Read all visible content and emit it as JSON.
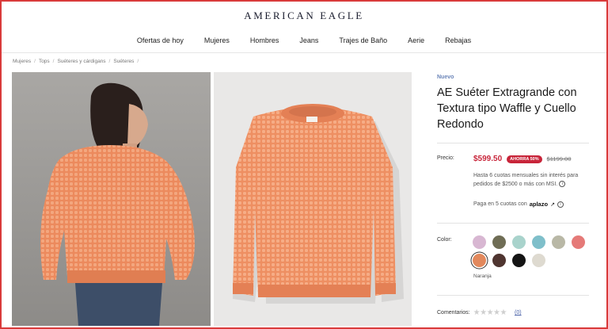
{
  "header": {
    "logo": "AMERICAN EAGLE",
    "nav": [
      "Ofertas de hoy",
      "Mujeres",
      "Hombres",
      "Jeans",
      "Trajes de Baño",
      "Aerie",
      "Rebajas"
    ]
  },
  "breadcrumb": [
    "Mujeres",
    "Tops",
    "Suéteres y cárdigans",
    "Suéteres"
  ],
  "product": {
    "badge": "Nuevo",
    "title": "AE Suéter Extragrande con Textura tipo Waffle y Cuello Redondo",
    "price_label": "Precio:",
    "price_now": "$599.50",
    "discount_badge": "AHORRA 50%",
    "price_was": "$1199.00",
    "msi_line1": "Hasta 6 cuotas mensuales sin interés para",
    "msi_line2": "pedidos de $2500 o más con MSI.",
    "aplazo_text": "Paga en 5 cuotas con",
    "aplazo_logo": "aplazo",
    "color_label": "Color:",
    "selected_color_name": "Naranja",
    "reviews_label": "Comentarios:",
    "review_count": "(0)",
    "rating_stars": 0
  },
  "swatches": [
    {
      "name": "lavender",
      "hex": "#d8b7d2"
    },
    {
      "name": "olive",
      "hex": "#6f6d55"
    },
    {
      "name": "mint",
      "hex": "#a9d3cc"
    },
    {
      "name": "teal",
      "hex": "#7fbfca"
    },
    {
      "name": "sage",
      "hex": "#b9b8a6"
    },
    {
      "name": "coral",
      "hex": "#e57a78"
    },
    {
      "name": "orange",
      "hex": "#e2885c",
      "selected": true
    },
    {
      "name": "brown",
      "hex": "#4f3530"
    },
    {
      "name": "black",
      "hex": "#141414"
    },
    {
      "name": "cream",
      "hex": "#dedad0"
    }
  ],
  "colors": {
    "accent_red": "#c8253a",
    "sweater_orange": "#ec8d61",
    "link_blue": "#4a62a8"
  }
}
